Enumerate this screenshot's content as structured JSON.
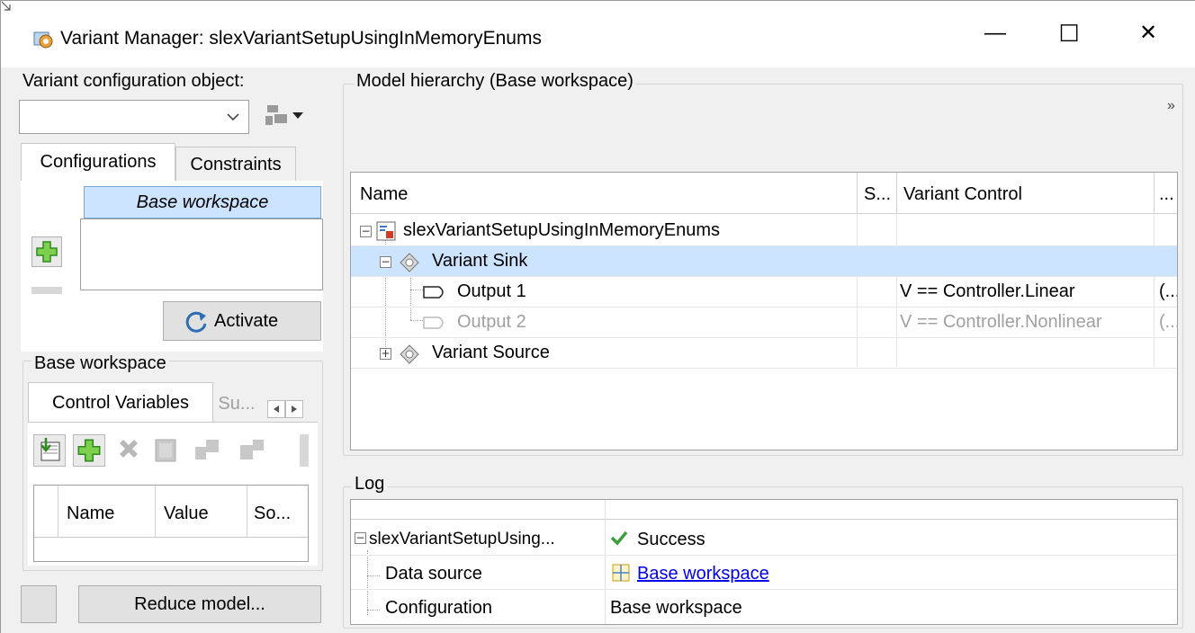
{
  "window": {
    "title": "Variant Manager: slexVariantSetupUsingInMemoryEnums",
    "minimize": "—",
    "maximize": "☐",
    "close": "✕"
  },
  "left": {
    "config_label": "Variant configuration object:",
    "config_value": "",
    "tabs": [
      "Configurations",
      "Constraints"
    ],
    "config_list_item": "Base workspace",
    "activate_label": "Activate",
    "workspace_group": "Base workspace",
    "ws_tabs": [
      "Control Variables",
      "Su..."
    ],
    "var_table_headers": [
      "Name",
      "Value",
      "So..."
    ],
    "reduce_label": "Reduce model..."
  },
  "hierarchy": {
    "group_label": "Model hierarchy (Base workspace)",
    "more": "»",
    "headers": [
      "Name",
      "S...",
      "Variant Control",
      "..."
    ],
    "rows": [
      {
        "name": "slexVariantSetupUsingInMemoryEnums",
        "control": "",
        "extra": ""
      },
      {
        "name": "Variant Sink",
        "control": "",
        "extra": ""
      },
      {
        "name": "Output 1",
        "control": "V == Controller.Linear",
        "extra": "(..."
      },
      {
        "name": "Output 2",
        "control": "V == Controller.Nonlinear",
        "extra": "(..."
      },
      {
        "name": "Variant Source",
        "control": "",
        "extra": ""
      }
    ]
  },
  "log": {
    "group_label": "Log",
    "rows": [
      {
        "name": "slexVariantSetupUsing...",
        "value": "Success"
      },
      {
        "name": "Data source",
        "value": "Base workspace"
      },
      {
        "name": "Configuration",
        "value": "Base workspace"
      }
    ]
  },
  "colors": {
    "selection": "#cce4ff",
    "link": "#0000ee",
    "success": "#3aa03a"
  }
}
